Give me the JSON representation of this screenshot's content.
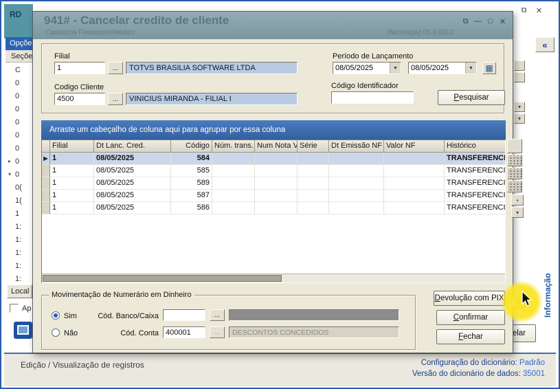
{
  "chrome": {
    "app_badge": "RD",
    "cancel_label": "Cancelar",
    "info_sidebar_label": "Informação"
  },
  "glyphs": {
    "restore": "⧉",
    "minimize": "—",
    "maximize": "□",
    "close": "✕",
    "collapse": "«",
    "browse": "...",
    "dropdown": "▼",
    "calendar": "▦",
    "row_marker": "▶",
    "scroll_down": "▾",
    "small_square": "▪"
  },
  "sidebar": {
    "tab_top": "Opções",
    "tab_second": "Seções",
    "tree_items": [
      {
        "arrow": "",
        "text": "C"
      },
      {
        "arrow": "",
        "text": "0"
      },
      {
        "arrow": "",
        "text": "0"
      },
      {
        "arrow": "",
        "text": "0"
      },
      {
        "arrow": "",
        "text": "0"
      },
      {
        "arrow": "",
        "text": "0"
      },
      {
        "arrow": "",
        "text": "0"
      },
      {
        "arrow": "▸",
        "text": "0"
      },
      {
        "arrow": "▾",
        "text": "0"
      },
      {
        "arrow": "",
        "text": "0("
      },
      {
        "arrow": "",
        "text": "1("
      },
      {
        "arrow": "",
        "text": "1"
      },
      {
        "arrow": "",
        "text": "1:"
      },
      {
        "arrow": "",
        "text": "1:"
      },
      {
        "arrow": "",
        "text": "1:"
      },
      {
        "arrow": "",
        "text": "1:"
      },
      {
        "arrow": "",
        "text": "1:"
      }
    ],
    "local_label": "Local",
    "approve_checkbox_label": "Ap"
  },
  "modal": {
    "title": "941# - Cancelar credito de cliente",
    "subtitle_left": "Cadastros Financeiro/Medico",
    "subtitle_right": "(Microsiga) 01.9.0012",
    "form": {
      "filial_label": "Filial",
      "filial_value": "1",
      "filial_name": "TOTVS BRASILIA SOFTWARE LTDA",
      "periodo_label": "Período de Lançamento",
      "periodo_from": "08/05/2025",
      "periodo_to": "08/05/2025",
      "cliente_label": "Codigo Cliente",
      "cliente_value": "4500",
      "cliente_name": "VINICIUS MIRANDA - FILIAL I",
      "identificador_label": "Código Identificador",
      "identificador_value": "",
      "pesquisar_label": "Pesquisar"
    },
    "group_bar_text": "Arraste um cabeçalho de coluna aqui para agrupar por essa coluna",
    "grid": {
      "columns": [
        "",
        "Filial",
        "Dt Lanc. Cred.",
        "Código",
        "Núm. trans.",
        "Num Nota V",
        "Série",
        "Dt Emissão NF",
        "Valor NF",
        "Histórico"
      ],
      "rows": [
        {
          "selected": true,
          "cells": [
            "1",
            "08/05/2025",
            "584",
            "",
            "",
            "",
            "",
            "",
            "TRANSFERENCIA"
          ]
        },
        {
          "selected": false,
          "cells": [
            "1",
            "08/05/2025",
            "585",
            "",
            "",
            "",
            "",
            "",
            "TRANSFERENCIA"
          ]
        },
        {
          "selected": false,
          "cells": [
            "1",
            "08/05/2025",
            "589",
            "",
            "",
            "",
            "",
            "",
            "TRANSFERENCIA"
          ]
        },
        {
          "selected": false,
          "cells": [
            "1",
            "08/05/2025",
            "587",
            "",
            "",
            "",
            "",
            "",
            "TRANSFERENCIA"
          ]
        },
        {
          "selected": false,
          "cells": [
            "1",
            "08/05/2025",
            "586",
            "",
            "",
            "",
            "",
            "",
            "TRANSFERENCIA"
          ]
        }
      ]
    },
    "mov": {
      "title": "Movimentação de Numerário em Dinheiro",
      "sim_label": "Sim",
      "nao_label": "Não",
      "banco_label": "Cód. Banco/Caixa",
      "banco_value": "",
      "conta_label": "Cód. Conta",
      "conta_value": "400001",
      "conta_desc": "DESCONTOS CONCEDIDOS"
    },
    "buttons": {
      "devolucao": "Devolução com PIX",
      "confirmar": "Confirmar",
      "fechar": "Fechar"
    }
  },
  "statusbar": {
    "left_text": "Edição / Visualização de registros",
    "dict_config_label": "Configuração do dicionário: ",
    "dict_config_value": "Padrão",
    "dict_version_label": "Versão do dicionário de dados: ",
    "dict_version_value": "35001"
  },
  "colors": {
    "titlebar_teal": "#5596a5",
    "group_bar_blue": "#3a68ad",
    "row_selection": "#ccd6ea",
    "field_highlight": "#b9cbe3",
    "link_blue": "#2e6cd8",
    "status_border_blue": "#3a6ea5",
    "click_highlight_yellow": "#fae41e"
  }
}
